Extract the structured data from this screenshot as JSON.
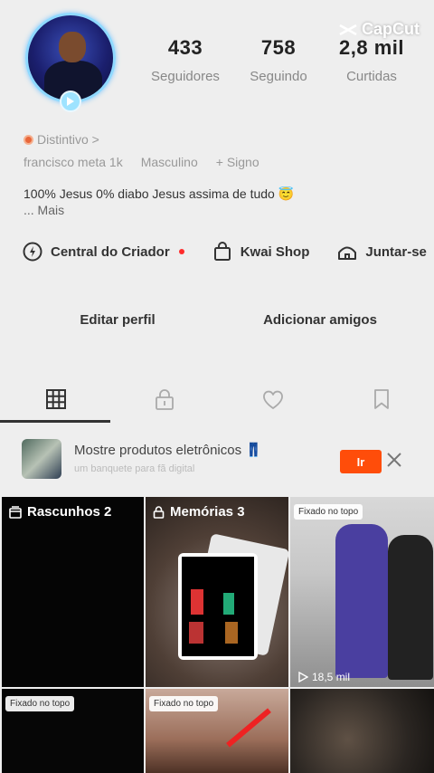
{
  "watermark": {
    "label": "CapCut"
  },
  "profile": {
    "stats": [
      {
        "value": "433",
        "label": "Seguidores"
      },
      {
        "value": "758",
        "label": "Seguindo"
      },
      {
        "value": "2,8 mil",
        "label": "Curtidas"
      }
    ],
    "badge": "Distintivo >",
    "info": [
      "francisco meta 1k",
      "Masculino",
      "+ Signo"
    ],
    "bio": "100% Jesus 0% diabo Jesus assima de tudo 😇",
    "bio_more": "... Mais"
  },
  "shortcuts": {
    "creator_center": "Central do Criador",
    "kwai_shop": "Kwai Shop",
    "join": "Juntar-se"
  },
  "actions": {
    "edit_profile": "Editar perfil",
    "add_friends": "Adicionar amigos"
  },
  "promo": {
    "title": "Mostre produtos eletrônicos 👖",
    "subtitle": "um banquete para fã digital",
    "go_label": "Ir"
  },
  "grid": {
    "drafts": "Rascunhos 2",
    "memories": "Memórias 3",
    "pinned_label": "Fixado no topo",
    "video_views": "18,5 mil"
  },
  "colors": {
    "accent": "#ff4d0a",
    "notification_dot": "#ff2b2b",
    "background": "#eeeeee"
  }
}
